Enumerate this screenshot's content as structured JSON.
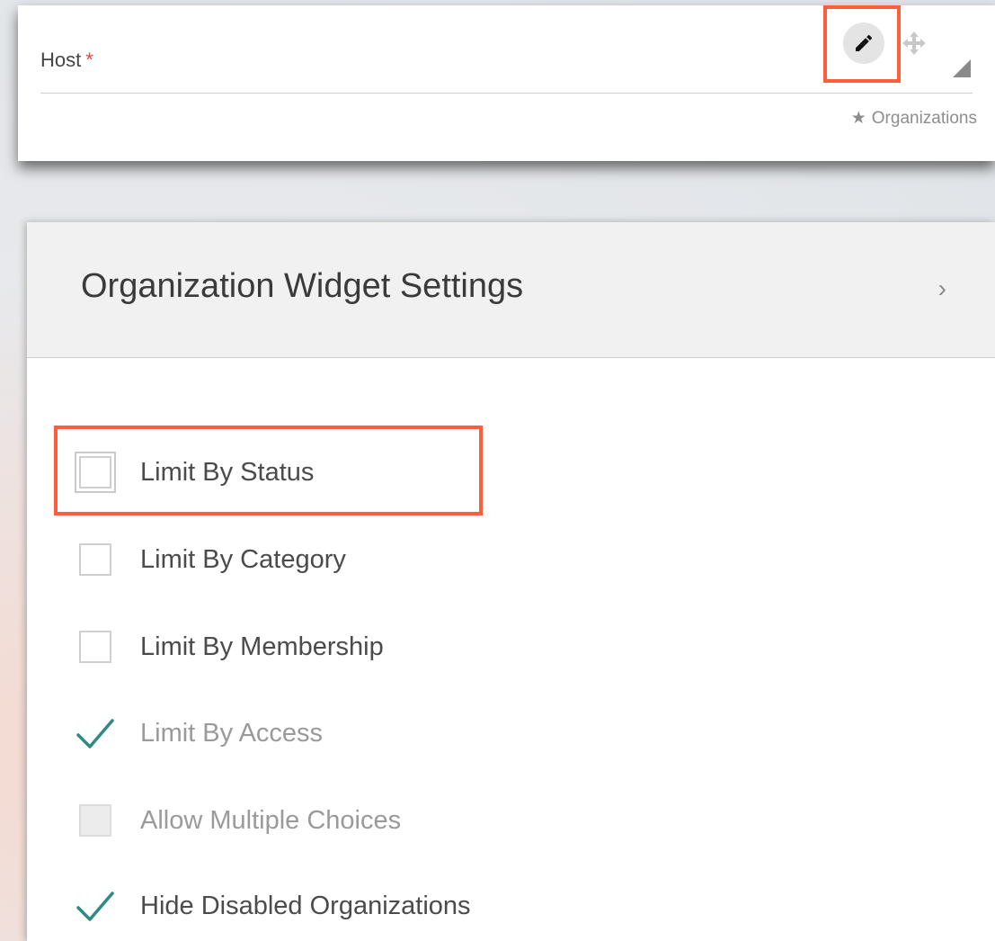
{
  "field": {
    "label": "Host",
    "required_marker": "*",
    "source_tag": "Organizations",
    "icons": {
      "edit": "pencil-icon",
      "move": "move-arrows-icon",
      "resize": "resize-corner-icon",
      "tag": "star-icon"
    }
  },
  "settings": {
    "title": "Organization Widget Settings",
    "chevron": "›",
    "options": [
      {
        "label": "Limit By Status",
        "state": "unchecked"
      },
      {
        "label": "Limit By Category",
        "state": "unchecked"
      },
      {
        "label": "Limit By Membership",
        "state": "unchecked"
      },
      {
        "label": "Limit By Access",
        "state": "checked"
      },
      {
        "label": "Allow Multiple Choices",
        "state": "disabled"
      },
      {
        "label": "Hide Disabled Organizations",
        "state": "checked"
      }
    ]
  },
  "colors": {
    "highlight": "#ff5e3a",
    "check": "#2f8a84",
    "required": "#e0483d"
  }
}
